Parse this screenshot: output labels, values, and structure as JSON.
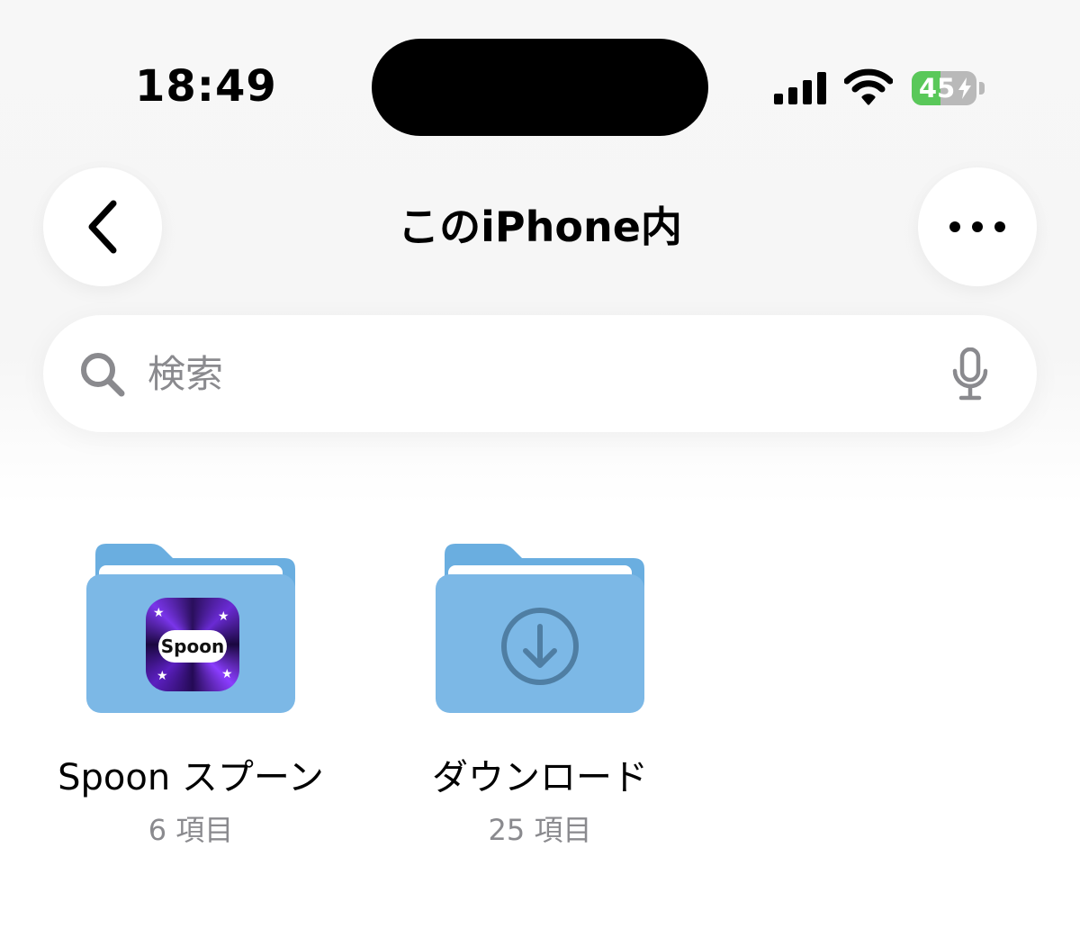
{
  "status_bar": {
    "time": "18:49",
    "battery_percent": "45",
    "battery_level": 0.45,
    "signal_bars": 4,
    "charging": true
  },
  "nav": {
    "title": "このiPhone内",
    "back_icon": "chevron-left-icon",
    "more_icon": "ellipsis-icon"
  },
  "search": {
    "placeholder": "検索",
    "value": "",
    "icon": "search-icon",
    "mic_icon": "microphone-icon"
  },
  "folders": [
    {
      "name": "Spoon スプーン",
      "count": "6 項目",
      "badge": "Spoon",
      "icon": "spoon-app-icon"
    },
    {
      "name": "ダウンロード",
      "count": "25 項目",
      "icon": "download-icon"
    }
  ],
  "colors": {
    "folder_blue": "#7cb8e6",
    "folder_tab": "#6aaee0",
    "battery_green": "#5ac85a",
    "secondary_text": "#8a8a8e"
  }
}
